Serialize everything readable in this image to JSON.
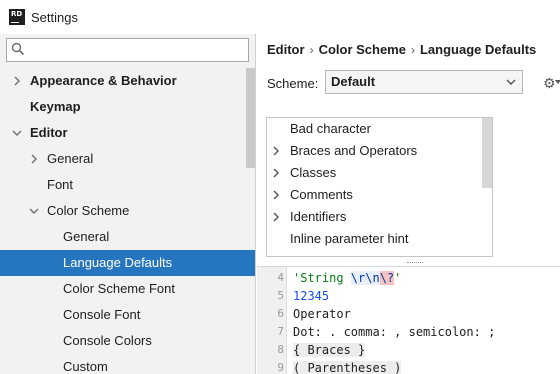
{
  "window": {
    "title": "Settings",
    "icon_text": "RD",
    "icon": "rider-app-icon"
  },
  "search": {
    "value": "",
    "placeholder": ""
  },
  "sidebar": {
    "items": [
      {
        "label": "Appearance & Behavior",
        "bold": true,
        "expandable": true,
        "expanded": false,
        "level": 0
      },
      {
        "label": "Keymap",
        "bold": true,
        "expandable": false,
        "level": 0
      },
      {
        "label": "Editor",
        "bold": true,
        "expandable": true,
        "expanded": true,
        "level": 0
      },
      {
        "label": "General",
        "bold": false,
        "expandable": true,
        "expanded": false,
        "level": 1
      },
      {
        "label": "Font",
        "bold": false,
        "expandable": false,
        "level": 1
      },
      {
        "label": "Color Scheme",
        "bold": false,
        "expandable": true,
        "expanded": true,
        "level": 1
      },
      {
        "label": "General",
        "bold": false,
        "expandable": false,
        "level": 2
      },
      {
        "label": "Language Defaults",
        "bold": false,
        "expandable": false,
        "level": 2,
        "selected": true
      },
      {
        "label": "Color Scheme Font",
        "bold": false,
        "expandable": false,
        "level": 2
      },
      {
        "label": "Console Font",
        "bold": false,
        "expandable": false,
        "level": 2
      },
      {
        "label": "Console Colors",
        "bold": false,
        "expandable": false,
        "level": 2
      },
      {
        "label": "Custom",
        "bold": false,
        "expandable": false,
        "level": 2
      }
    ]
  },
  "breadcrumb": {
    "items": [
      "Editor",
      "Color Scheme",
      "Language Defaults"
    ],
    "separator": "›"
  },
  "scheme": {
    "label": "Scheme:",
    "selected": "Default"
  },
  "categories": {
    "items": [
      {
        "label": "Bad character",
        "expandable": false
      },
      {
        "label": "Braces and Operators",
        "expandable": true
      },
      {
        "label": "Classes",
        "expandable": true
      },
      {
        "label": "Comments",
        "expandable": true
      },
      {
        "label": "Identifiers",
        "expandable": true
      },
      {
        "label": "Inline parameter hint",
        "expandable": false
      }
    ]
  },
  "preview": {
    "lines": [
      {
        "n": "4",
        "parts": [
          {
            "t": "'String ",
            "c": "c-str"
          },
          {
            "t": "\\r",
            "c": "c-esc"
          },
          {
            "t": "\\n",
            "c": "c-esc"
          },
          {
            "t": "\\?",
            "c": "c-bad"
          },
          {
            "t": "'",
            "c": "c-str"
          }
        ]
      },
      {
        "n": "5",
        "parts": [
          {
            "t": "12345",
            "c": "c-num"
          }
        ]
      },
      {
        "n": "6",
        "parts": [
          {
            "t": "Operator",
            "c": "c-plain"
          }
        ]
      },
      {
        "n": "7",
        "parts": [
          {
            "t": "Dot: . comma: , semicolon: ;",
            "c": "c-plain"
          }
        ]
      },
      {
        "n": "8",
        "parts": [
          {
            "t": "{ Braces }",
            "c": "c-brace"
          }
        ]
      },
      {
        "n": "9",
        "parts": [
          {
            "t": "( Parentheses )",
            "c": "c-brace"
          }
        ]
      }
    ]
  },
  "colors": {
    "selection": "#2675bf",
    "sidebar_bg": "#f2f2f2",
    "string": "#067d17",
    "number": "#1750eb"
  }
}
